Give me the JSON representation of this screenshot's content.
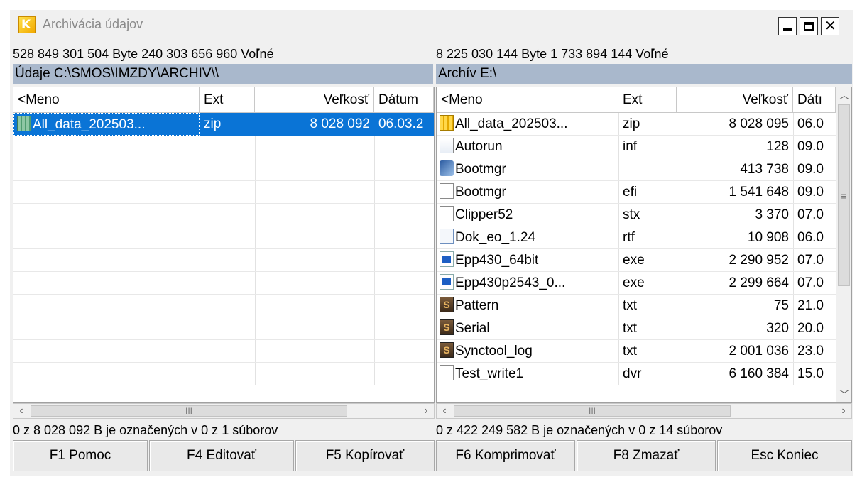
{
  "window": {
    "title": "Archivácia údajov",
    "app_icon_letter": "K"
  },
  "left": {
    "freeinfo": "528 849 301 504 Byte  240 303 656 960 Voľné",
    "path": "Údaje C:\\SMOS\\IMZDY\\ARCHIV\\\\",
    "columns": [
      "<Meno",
      "Ext",
      "Veľkosť",
      "Dátum"
    ],
    "rows": [
      {
        "name": "All_data_202503...",
        "ext": "zip",
        "size": "8 028 092",
        "date": "06.03.2",
        "icon": "zip-g",
        "selected": true
      }
    ],
    "status": "0 z 8 028 092 B je označených v 0 z 1 súborov",
    "hscroll_grip": "III"
  },
  "right": {
    "freeinfo": "8 225 030 144 Byte  1 733 894 144 Voľné",
    "path": "Archív E:\\",
    "columns": [
      "<Meno",
      "Ext",
      "Veľkosť",
      "Dátı"
    ],
    "rows": [
      {
        "name": "All_data_202503...",
        "ext": "zip",
        "size": "8 028 095",
        "date": "06.0",
        "icon": "zip"
      },
      {
        "name": "Autorun",
        "ext": "inf",
        "size": "128",
        "date": "09.0",
        "icon": "inf"
      },
      {
        "name": "Bootmgr",
        "ext": "",
        "size": "413 738",
        "date": "09.0",
        "icon": "sys"
      },
      {
        "name": "Bootmgr",
        "ext": "efi",
        "size": "1 541 648",
        "date": "09.0",
        "icon": "doc"
      },
      {
        "name": "Clipper52",
        "ext": "stx",
        "size": "3 370",
        "date": "07.0",
        "icon": "doc"
      },
      {
        "name": "Dok_eo_1.24",
        "ext": "rtf",
        "size": "10 908",
        "date": "06.0",
        "icon": "rtf"
      },
      {
        "name": "Epp430_64bit",
        "ext": "exe",
        "size": "2 290 952",
        "date": "07.0",
        "icon": "exe"
      },
      {
        "name": "Epp430p2543_0...",
        "ext": "exe",
        "size": "2 299 664",
        "date": "07.0",
        "icon": "exe"
      },
      {
        "name": "Pattern",
        "ext": "txt",
        "size": "75",
        "date": "21.0",
        "icon": "s"
      },
      {
        "name": "Serial",
        "ext": "txt",
        "size": "320",
        "date": "20.0",
        "icon": "s"
      },
      {
        "name": "Synctool_log",
        "ext": "txt",
        "size": "2 001 036",
        "date": "23.0",
        "icon": "s"
      },
      {
        "name": "Test_write1",
        "ext": "dvr",
        "size": "6 160 384",
        "date": "15.0",
        "icon": "doc"
      }
    ],
    "status": "0 z 422 249 582 B je označených v 0 z 14 súborov",
    "hscroll_grip": "III",
    "vscroll_grip": "≡"
  },
  "buttons": [
    {
      "label": "F1 Pomoc"
    },
    {
      "label": "F4 Editovať"
    },
    {
      "label": "F5 Kopírovať"
    },
    {
      "label": "F6 Komprimovať"
    },
    {
      "label": "F8 Zmazať"
    },
    {
      "label": "Esc Koniec"
    }
  ],
  "colors": {
    "selection": "#0a74d6",
    "pathbar": "#a9b8cc"
  }
}
